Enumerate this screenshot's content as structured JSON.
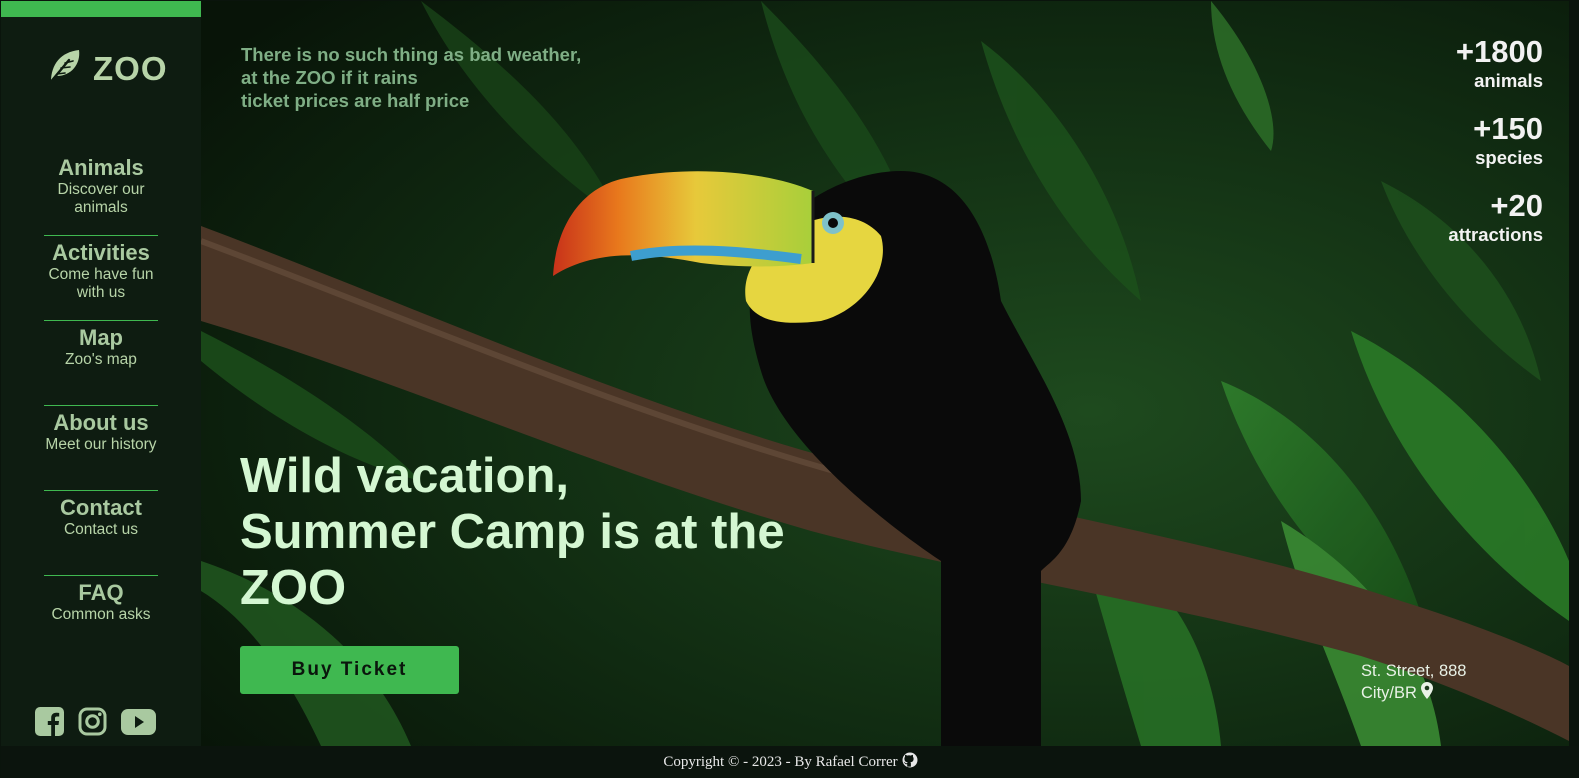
{
  "brand": {
    "name": "ZOO",
    "icon": "leaf-icon"
  },
  "nav": [
    {
      "title": "Animals",
      "subtitle": "Discover our animals"
    },
    {
      "title": "Activities",
      "subtitle": "Come have fun with us"
    },
    {
      "title": "Map",
      "subtitle": "Zoo's map"
    },
    {
      "title": "About us",
      "subtitle": "Meet our history"
    },
    {
      "title": "Contact",
      "subtitle": "Contact us"
    },
    {
      "title": "FAQ",
      "subtitle": "Common asks"
    }
  ],
  "socials": [
    "facebook-icon",
    "instagram-icon",
    "youtube-icon"
  ],
  "hero": {
    "quote_line1": "There is no such thing as bad weather,",
    "quote_line2": "at the ZOO if it rains",
    "quote_line3": "ticket prices are half price",
    "headline_line1": "Wild vacation,",
    "headline_line2": "Summer Camp is at the",
    "headline_line3": "ZOO",
    "buy_label": "Buy Ticket"
  },
  "stats": [
    {
      "value": "+1800",
      "label": "animals"
    },
    {
      "value": "+150",
      "label": "species"
    },
    {
      "value": "+20",
      "label": "attractions"
    }
  ],
  "address": {
    "street": "St. Street, 888",
    "city": "City/BR",
    "icon": "map-pin-icon"
  },
  "footer": {
    "text": "Copyright © - 2023 - By Rafael Correr",
    "icon": "github-icon"
  },
  "colors": {
    "accent": "#3fb850",
    "sidebar_bg": "#0e1c11",
    "headline": "#d4f7d2"
  }
}
